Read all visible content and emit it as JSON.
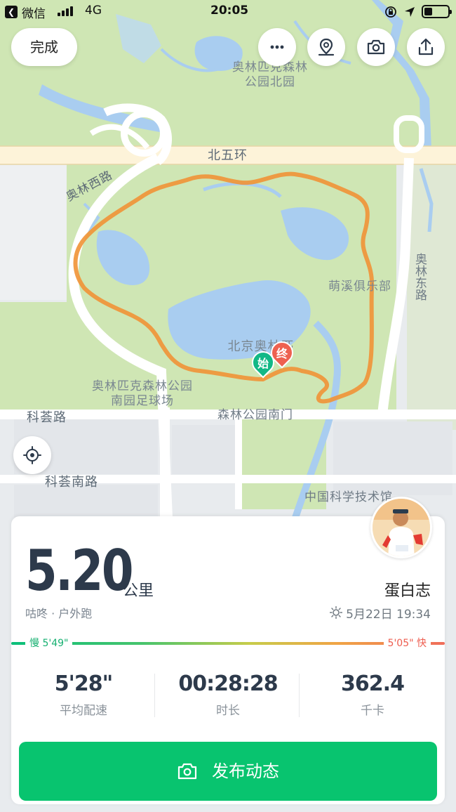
{
  "status_bar": {
    "back_app": "微信",
    "network": "4G",
    "time": "20:05",
    "battery_level": 0.35
  },
  "top_bar": {
    "done_label": "完成",
    "icons": [
      "more-icon",
      "location-pin-icon",
      "camera-icon",
      "share-icon"
    ]
  },
  "map": {
    "labels": {
      "park_north": "奥林匹克森林公园北园",
      "north_ring": "北五环",
      "olympic_west_road": "奥林西路",
      "olympic_east_road": "奥林东路",
      "mengxi_club": "萌溪俱乐部",
      "beijing_olympic": "北京奥林匹克",
      "south_football": "奥林匹克森林公园南园足球场",
      "kehui_road": "科荟路",
      "forest_south_gate": "森林公园南门",
      "kehui_south_road": "科荟南路",
      "science_museum": "中国科学技术馆"
    },
    "start_marker": "始",
    "end_marker": "终",
    "route_color": "#f0953a",
    "start_color": "#12b886",
    "end_color": "#ee6150"
  },
  "summary": {
    "distance": "5.20",
    "unit": "公里",
    "source": "咕咚 · 户外跑",
    "username": "蛋白志",
    "datetime": "5月22日 19:34",
    "pace_slow": "慢 5'49\"",
    "pace_fast": "5'05\" 快",
    "stats": [
      {
        "value": "5'28\"",
        "label": "平均配速"
      },
      {
        "value": "00:28:28",
        "label": "时长"
      },
      {
        "value": "362.4",
        "label": "千卡"
      }
    ],
    "publish_label": "发布动态"
  },
  "colors": {
    "accent_green": "#08c46f",
    "text_dark": "#2d3a4b"
  }
}
